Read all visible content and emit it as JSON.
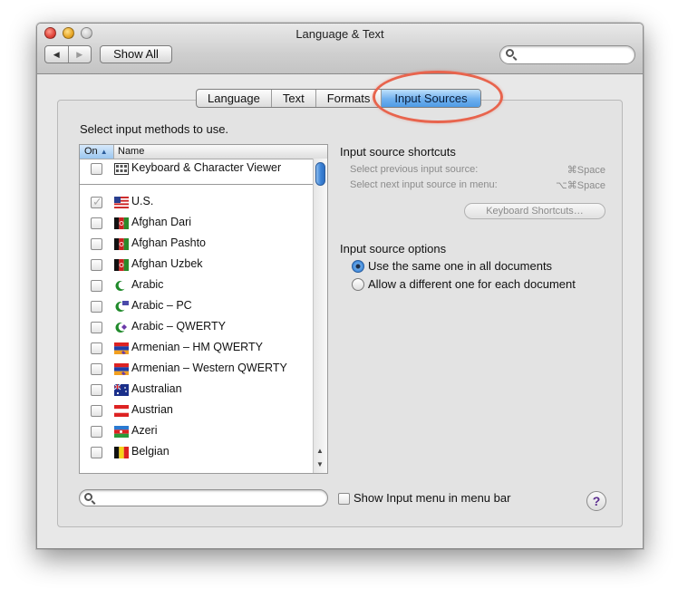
{
  "window": {
    "title": "Language & Text"
  },
  "toolbar": {
    "back_icon": "◀",
    "forward_icon": "▶",
    "show_all_label": "Show All",
    "search_placeholder": ""
  },
  "tabs": [
    {
      "label": "Language",
      "active": false
    },
    {
      "label": "Text",
      "active": false
    },
    {
      "label": "Formats",
      "active": false
    },
    {
      "label": "Input Sources",
      "active": true
    }
  ],
  "instruction": "Select input methods to use.",
  "list": {
    "col_on": "On",
    "col_name": "Name",
    "sort_icon": "▲",
    "top_item": {
      "label": "Keyboard & Character Viewer",
      "checked": false
    },
    "items": [
      {
        "label": "U.S.",
        "checked": true,
        "flag": "us-flag-icon"
      },
      {
        "label": "Afghan Dari",
        "checked": false,
        "flag": "afghan-flag-icon"
      },
      {
        "label": "Afghan Pashto",
        "checked": false,
        "flag": "afghan-flag-icon"
      },
      {
        "label": "Afghan Uzbek",
        "checked": false,
        "flag": "afghan-flag-icon"
      },
      {
        "label": "Arabic",
        "checked": false,
        "flag": "crescent-icon"
      },
      {
        "label": "Arabic – PC",
        "checked": false,
        "flag": "crescent-icon"
      },
      {
        "label": "Arabic – QWERTY",
        "checked": false,
        "flag": "crescent-icon"
      },
      {
        "label": "Armenian – HM QWERTY",
        "checked": false,
        "flag": "armenian-flag-icon"
      },
      {
        "label": "Armenian – Western QWERTY",
        "checked": false,
        "flag": "armenian-flag-icon"
      },
      {
        "label": "Australian",
        "checked": false,
        "flag": "australian-flag-icon"
      },
      {
        "label": "Austrian",
        "checked": false,
        "flag": "austrian-flag-icon"
      },
      {
        "label": "Azeri",
        "checked": false,
        "flag": "azeri-flag-icon"
      },
      {
        "label": "Belgian",
        "checked": false,
        "flag": "belgian-flag-icon"
      }
    ]
  },
  "shortcuts": {
    "title": "Input source shortcuts",
    "prev_label": "Select previous input source:",
    "prev_key": "⌘Space",
    "next_label": "Select next input source in menu:",
    "next_key": "⌥⌘Space",
    "button_label": "Keyboard Shortcuts…"
  },
  "options": {
    "title": "Input source options",
    "radio_same": "Use the same one in all documents",
    "radio_different": "Allow a different one for each document",
    "selected": "same"
  },
  "footer": {
    "search_placeholder": "",
    "show_menu_label": "Show Input menu in menu bar",
    "help_label": "?"
  },
  "colors": {
    "active_tab": "#6fb0ee",
    "highlight_oval": "#e8644d"
  }
}
